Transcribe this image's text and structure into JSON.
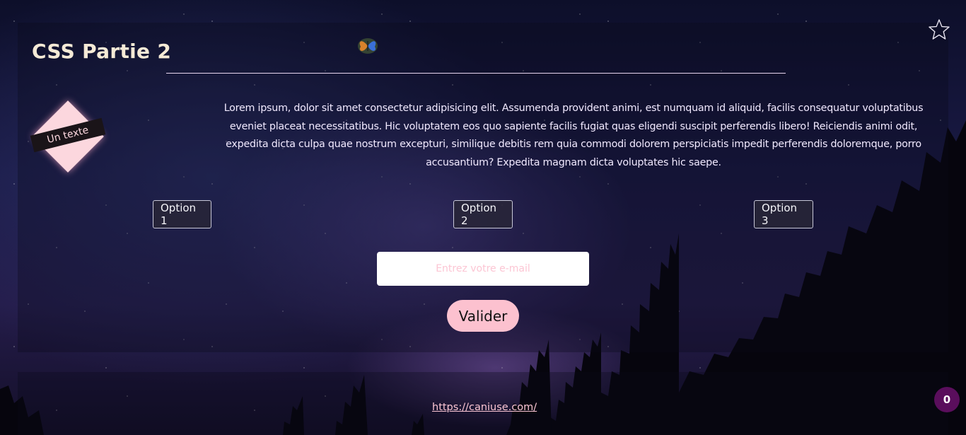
{
  "header": {
    "title": "CSS Partie 2"
  },
  "badge": {
    "text": "Un texte"
  },
  "main": {
    "paragraph": "Lorem ipsum, dolor sit amet consectetur adipisicing elit. Assumenda provident animi, est numquam id aliquid, facilis consequatur voluptatibus eveniet placeat necessitatibus. Hic voluptatem eos quo sapiente facilis fugiat quas eligendi suscipit perferendis libero! Reiciendis animi odit, expedita dicta culpa quae nostrum excepturi, similique debitis rem quia commodi dolorem perspiciatis impedit perferendis doloremque, porro accusantium? Expedita magnam dicta voluptates hic saepe.",
    "options": [
      {
        "label": "Option 1"
      },
      {
        "label": "Option 2"
      },
      {
        "label": "Option 3"
      }
    ]
  },
  "form": {
    "email_placeholder": "Entrez votre e-mail",
    "submit_label": "Valider"
  },
  "footer": {
    "link": "https://caniuse.com/"
  },
  "counter": {
    "value": "0"
  },
  "icons": {
    "favorite": "star-outline-icon",
    "decoration": "butterfly-icon"
  },
  "colors": {
    "accent_pink": "#fcc1cf",
    "badge_purple": "#5a0e5c",
    "title_cream": "#f5ead6"
  }
}
